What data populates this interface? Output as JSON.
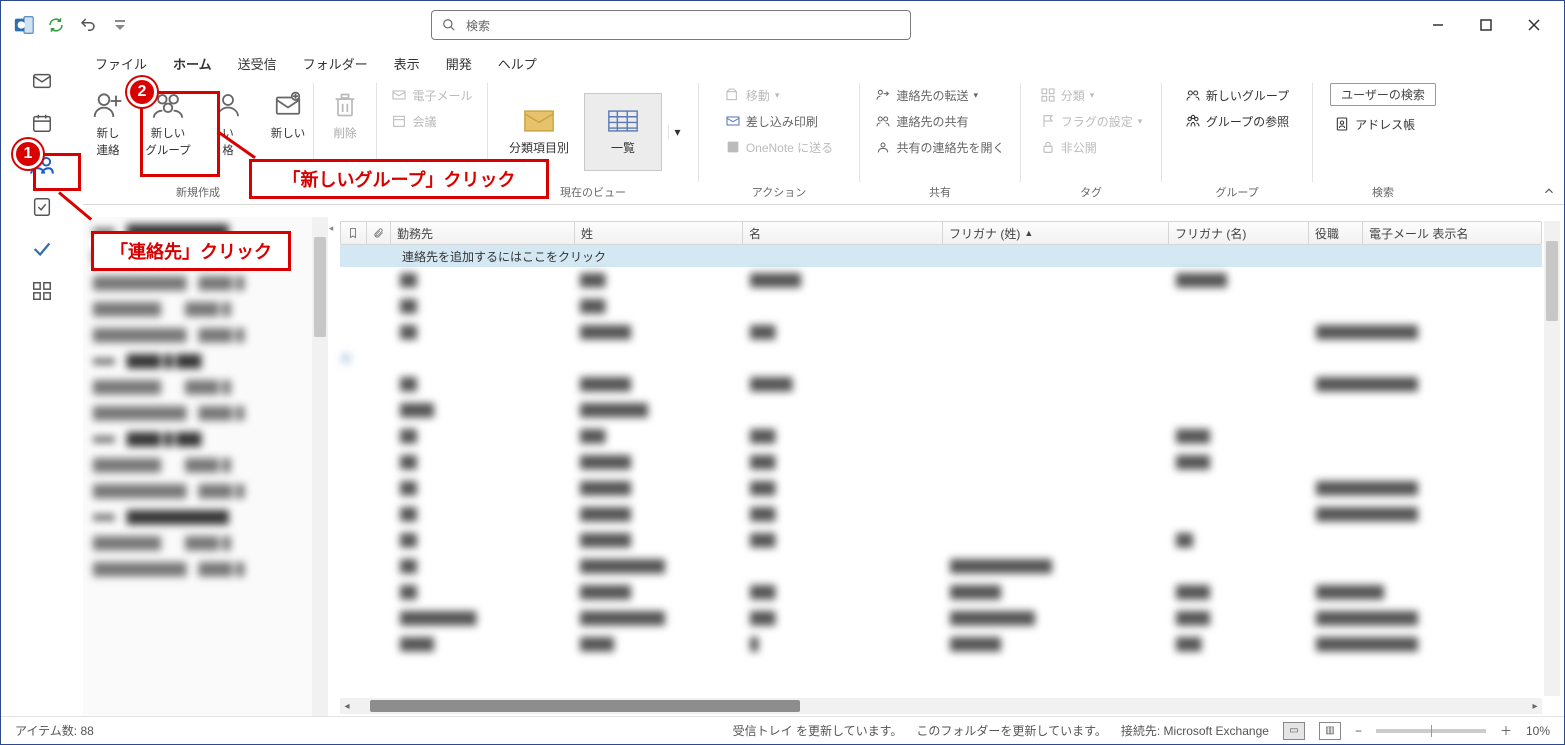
{
  "search_placeholder": "検索",
  "menu": {
    "file": "ファイル",
    "home": "ホーム",
    "sendrecv": "送受信",
    "folder": "フォルダー",
    "view": "表示",
    "develop": "開発",
    "help": "ヘルプ"
  },
  "ribbon": {
    "new_contact_a": "新し",
    "new_contact_b": "連絡",
    "new_group_a": "新しい",
    "new_group_b": "グループ",
    "new_other_a": "い",
    "new_other_b": "格",
    "new_item_a": "新しい",
    "new_item_b": "",
    "delete": "削除",
    "email": "電子メール",
    "meeting": "会議",
    "bycat": "分類項目別",
    "list": "一覧",
    "move": "移動",
    "mailmerge": "差し込み印刷",
    "onenote": "OneNote に送る",
    "fwd": "連絡先の転送",
    "share": "連絡先の共有",
    "openshared": "共有の連絡先を開く",
    "categorize": "分類",
    "flag": "フラグの設定",
    "private": "非公開",
    "newgroup2": "新しいグループ",
    "browsegroup": "グループの参照",
    "usersearch": "ユーザーの検索",
    "addressbook": "アドレス帳",
    "g_new": "新規作成",
    "g_view": "現在のビュー",
    "g_actions": "アクション",
    "g_share": "共有",
    "g_tag": "タグ",
    "g_groups": "グループ",
    "g_search": "検索"
  },
  "columns": {
    "company": "勤務先",
    "lastname": "姓",
    "firstname": "名",
    "furi_last": "フリガナ (姓)",
    "furi_first": "フリガナ (名)",
    "title": "役職",
    "email": "電子メール 表示名"
  },
  "newrow_text": "連絡先を追加するにはここをクリック",
  "status": {
    "items": "アイテム数: 88",
    "sync1": "受信トレイ を更新しています。",
    "sync2": "このフォルダーを更新しています。",
    "conn": "接続先: Microsoft Exchange",
    "zoom": "10%"
  },
  "annotations": {
    "a1": "「連絡先」クリック",
    "a2": "「新しいグループ」クリック",
    "b1": "1",
    "b2": "2"
  }
}
